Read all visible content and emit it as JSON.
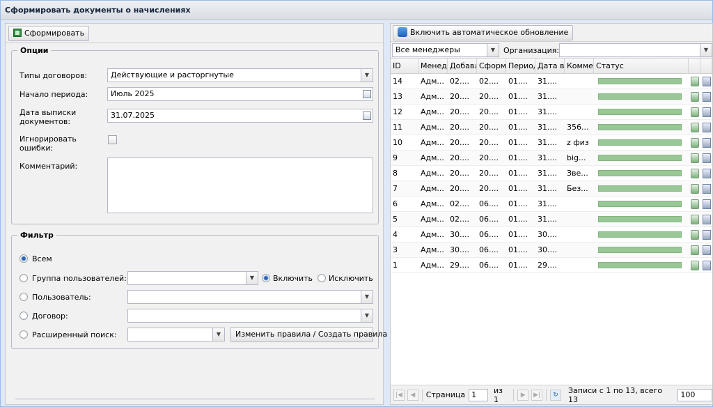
{
  "window": {
    "title": "Сформировать документы о начислениях"
  },
  "toolbar": {
    "generate_label": "Сформировать"
  },
  "options": {
    "legend": "Опции",
    "contract_types_label": "Типы договоров:",
    "contract_types_value": "Действующие и расторгнутые",
    "period_start_label": "Начало периода:",
    "period_start_value": "Июль 2025",
    "issue_date_label": "Дата выписки документов:",
    "issue_date_value": "31.07.2025",
    "ignore_errors_label": "Игнорировать ошибки:",
    "comment_label": "Комментарий:"
  },
  "filter": {
    "legend": "Фильтр",
    "all_label": "Всем",
    "user_group_label": "Группа пользователей:",
    "include_label": "Включить",
    "exclude_label": "Исключить",
    "user_label": "Пользователь:",
    "contract_label": "Договор:",
    "advanced_label": "Расширенный поиск:",
    "rules_button": "Изменить правила / Создать правила"
  },
  "right": {
    "auto_update_label": "Включить автоматическое обновление",
    "managers_value": "Все менеджеры",
    "org_label": "Организация:",
    "columns": [
      "ID",
      "Менедж",
      "Добавл",
      "Сформ",
      "Период",
      "Дата в",
      "Комме",
      "Статус"
    ],
    "rows": [
      {
        "id": "14",
        "m": "Адм...",
        "a": "02....",
        "f": "02....",
        "p": "01....",
        "d": "31....",
        "c": ""
      },
      {
        "id": "13",
        "m": "Адм...",
        "a": "20....",
        "f": "20....",
        "p": "01....",
        "d": "31....",
        "c": ""
      },
      {
        "id": "12",
        "m": "Адм...",
        "a": "20....",
        "f": "20....",
        "p": "01....",
        "d": "31....",
        "c": ""
      },
      {
        "id": "11",
        "m": "Адм...",
        "a": "20....",
        "f": "20....",
        "p": "01....",
        "d": "31....",
        "c": "356..."
      },
      {
        "id": "10",
        "m": "Адм...",
        "a": "20....",
        "f": "20....",
        "p": "01....",
        "d": "31....",
        "c": "z физ"
      },
      {
        "id": "9",
        "m": "Адм...",
        "a": "20....",
        "f": "20....",
        "p": "01....",
        "d": "31....",
        "c": "big..."
      },
      {
        "id": "8",
        "m": "Адм...",
        "a": "20....",
        "f": "20....",
        "p": "01....",
        "d": "31....",
        "c": "Зве..."
      },
      {
        "id": "7",
        "m": "Адм...",
        "a": "20....",
        "f": "20....",
        "p": "01....",
        "d": "31....",
        "c": "Без..."
      },
      {
        "id": "6",
        "m": "Адм...",
        "a": "02....",
        "f": "06....",
        "p": "01....",
        "d": "31....",
        "c": ""
      },
      {
        "id": "5",
        "m": "Адм...",
        "a": "02....",
        "f": "06....",
        "p": "01....",
        "d": "31....",
        "c": ""
      },
      {
        "id": "4",
        "m": "Адм...",
        "a": "30....",
        "f": "06....",
        "p": "01....",
        "d": "30....",
        "c": ""
      },
      {
        "id": "3",
        "m": "Адм...",
        "a": "30....",
        "f": "06....",
        "p": "01....",
        "d": "30....",
        "c": ""
      },
      {
        "id": "1",
        "m": "Адм...",
        "a": "29....",
        "f": "06....",
        "p": "01....",
        "d": "29....",
        "c": ""
      }
    ],
    "pager": {
      "page_label": "Страница",
      "page_value": "1",
      "of_label": "из 1",
      "records_label": "Записи с 1 по 13, всего 13",
      "page_size": "100"
    }
  }
}
